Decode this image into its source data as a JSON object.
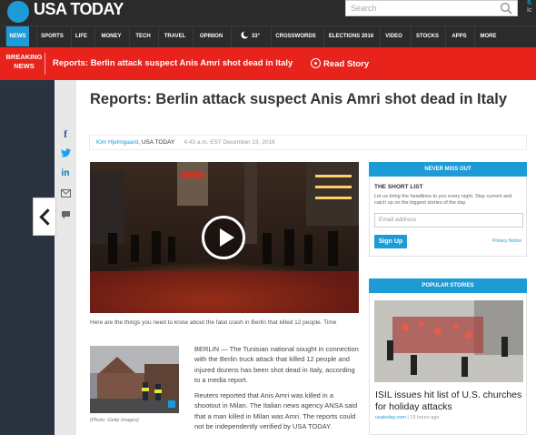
{
  "header": {
    "logo_text": "USA TODAY",
    "search_placeholder": "Search",
    "right_edge_1": "S",
    "right_edge_2": "Ic"
  },
  "nav": {
    "items": [
      {
        "label": "NEWS",
        "active": true
      },
      {
        "label": "SPORTS"
      },
      {
        "label": "LIFE"
      },
      {
        "label": "MONEY"
      },
      {
        "label": "TECH"
      },
      {
        "label": "TRAVEL"
      },
      {
        "label": "OPINION"
      },
      {
        "label": "33°",
        "icon": "weather-moon-icon"
      },
      {
        "label": "CROSSWORDS"
      },
      {
        "label": "ELECTIONS 2016"
      },
      {
        "label": "VIDEO"
      },
      {
        "label": "STOCKS"
      },
      {
        "label": "APPS"
      },
      {
        "label": "MORE"
      }
    ]
  },
  "breaking": {
    "label_line1": "BREAKING",
    "label_line2": "NEWS",
    "headline": "Reports: Berlin attack suspect Anis Amri shot dead in Italy",
    "read_story": "Read Story"
  },
  "share": {
    "icons": [
      "facebook-icon",
      "twitter-icon",
      "linkedin-icon",
      "email-icon",
      "comment-icon"
    ],
    "facebook_glyph": "f",
    "linkedin_glyph": "in"
  },
  "article": {
    "headline": "Reports: Berlin attack suspect Anis Amri shot dead in Italy",
    "author": "Kim Hjelmgaard",
    "publisher": ", USA TODAY",
    "timestamp": "4:43 a.m. EST December 23, 2016",
    "video_caption": "Here are the things you need to know about the fatal crash in Berlin that killed 12 people. Time",
    "photo_credit": "(Photo: Getty Images)",
    "paragraph_1": "BERLIN — The Tunisian national sought in connection with the Berlin truck attack that killed 12 people and injured dozens has been shot dead in Italy, according to a media report.",
    "paragraph_2": "Reuters reported that Anis Amri was killed in a shootout in Milan. The Italian news agency ANSA said that a man killed in Milan was Amri. The reports could not be independently verified by USA TODAY."
  },
  "sidebar": {
    "never_miss_out": "NEVER MISS OUT",
    "short_list_title": "THE SHORT LIST",
    "short_list_desc": "Let us bring the headlines to you every night. Stay current and catch up on the biggest stories of the day.",
    "email_placeholder": "Email address",
    "signup_label": "Sign Up",
    "privacy_label": "Privacy Notice",
    "popular_stories": "POPULAR STORIES",
    "popular_headline": "ISIL issues hit list of U.S. churches for holiday attacks",
    "popular_source": "usatoday.com",
    "popular_time": "13 hours ago"
  },
  "colors": {
    "brand_blue": "#1d9bd7",
    "breaking_red": "#e8231c",
    "header_dark": "#2b2b2b"
  }
}
